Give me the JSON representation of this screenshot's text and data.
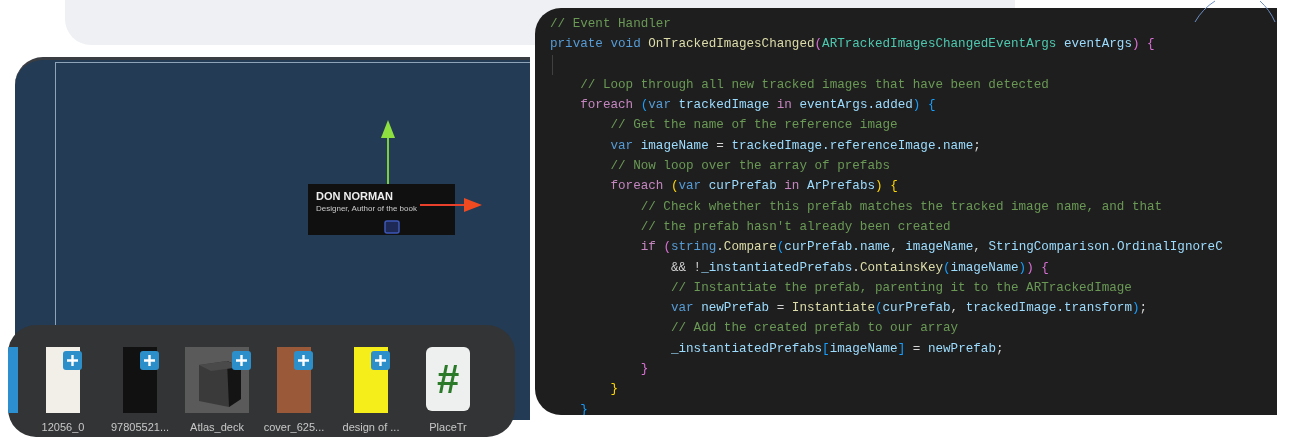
{
  "scene_view": {
    "card": {
      "title": "DON NORMAN",
      "subtitle": "Designer, Author of the book"
    }
  },
  "asset_strip": {
    "items": [
      {
        "kind": "photo",
        "color": "#2b8fd0"
      },
      {
        "kind": "photo",
        "label": "12056_0",
        "color": "#f2efe9"
      },
      {
        "kind": "photo",
        "label": "97805521...",
        "color": "#111111"
      },
      {
        "kind": "cube",
        "label": "Atlas_deck"
      },
      {
        "kind": "photo",
        "label": "cover_625...",
        "color": "#9a5a3a"
      },
      {
        "kind": "photo",
        "label": "design of ...",
        "color": "#f5ee1a"
      },
      {
        "kind": "script",
        "label": "PlaceTr",
        "glyph": "#"
      }
    ]
  },
  "code_editor": {
    "lines": [
      {
        "tokens": [
          {
            "kind": "comment",
            "text": "// Event Handler"
          }
        ]
      },
      {
        "tokens": [
          {
            "kind": "keyword",
            "text": "private void "
          },
          {
            "kind": "method",
            "text": "OnTrackedImagesChanged"
          },
          {
            "kind": "bracket2",
            "text": "("
          },
          {
            "kind": "type",
            "text": "ARTrackedImagesChangedEventArgs "
          },
          {
            "kind": "variable",
            "text": "eventArgs"
          },
          {
            "kind": "bracket2",
            "text": ") {"
          }
        ]
      },
      {
        "kind": "blank"
      },
      {
        "tokens": [
          {
            "kind": "comment",
            "text": "    // Loop through all new tracked images that have been detected"
          }
        ]
      },
      {
        "tokens": [
          {
            "kind": "control",
            "text": "    foreach "
          },
          {
            "kind": "bracket3",
            "text": "("
          },
          {
            "kind": "keyword",
            "text": "var "
          },
          {
            "kind": "variable",
            "text": "trackedImage "
          },
          {
            "kind": "control",
            "text": "in "
          },
          {
            "kind": "variable",
            "text": "eventArgs.added"
          },
          {
            "kind": "bracket3",
            "text": ") {"
          }
        ]
      },
      {
        "tokens": [
          {
            "kind": "comment",
            "text": "        // Get the name of the reference image"
          }
        ]
      },
      {
        "tokens": [
          {
            "kind": "keyword",
            "text": "        var "
          },
          {
            "kind": "variable",
            "text": "imageName "
          },
          {
            "kind": "plain",
            "text": "= "
          },
          {
            "kind": "variable",
            "text": "trackedImage.referenceImage.name"
          },
          {
            "kind": "plain",
            "text": ";"
          }
        ]
      },
      {
        "tokens": [
          {
            "kind": "comment",
            "text": "        // Now loop over the array of prefabs"
          }
        ]
      },
      {
        "tokens": [
          {
            "kind": "control",
            "text": "        foreach "
          },
          {
            "kind": "bracket1",
            "text": "("
          },
          {
            "kind": "keyword",
            "text": "var "
          },
          {
            "kind": "variable",
            "text": "curPrefab "
          },
          {
            "kind": "control",
            "text": "in "
          },
          {
            "kind": "variable",
            "text": "ArPrefabs"
          },
          {
            "kind": "bracket1",
            "text": ") {"
          }
        ]
      },
      {
        "tokens": [
          {
            "kind": "comment",
            "text": "            // Check whether this prefab matches the tracked image name, and that"
          }
        ]
      },
      {
        "tokens": [
          {
            "kind": "comment",
            "text": "            // the prefab hasn't already been created"
          }
        ]
      },
      {
        "tokens": [
          {
            "kind": "control",
            "text": "            if "
          },
          {
            "kind": "bracket2",
            "text": "("
          },
          {
            "kind": "keyword",
            "text": "string"
          },
          {
            "kind": "plain",
            "text": "."
          },
          {
            "kind": "method",
            "text": "Compare"
          },
          {
            "kind": "bracket3",
            "text": "("
          },
          {
            "kind": "variable",
            "text": "curPrefab.name"
          },
          {
            "kind": "plain",
            "text": ", "
          },
          {
            "kind": "variable",
            "text": "imageName"
          },
          {
            "kind": "plain",
            "text": ", "
          },
          {
            "kind": "variable",
            "text": "StringComparison.OrdinalIgnoreC"
          }
        ]
      },
      {
        "tokens": [
          {
            "kind": "plain",
            "text": "                && !"
          },
          {
            "kind": "variable",
            "text": "_instantiatedPrefabs"
          },
          {
            "kind": "plain",
            "text": "."
          },
          {
            "kind": "method",
            "text": "ContainsKey"
          },
          {
            "kind": "bracket3",
            "text": "("
          },
          {
            "kind": "variable",
            "text": "imageName"
          },
          {
            "kind": "bracket3",
            "text": ")"
          },
          {
            "kind": "bracket2",
            "text": ") {"
          }
        ]
      },
      {
        "tokens": [
          {
            "kind": "comment",
            "text": "                // Instantiate the prefab, parenting it to the ARTrackedImage"
          }
        ]
      },
      {
        "tokens": [
          {
            "kind": "keyword",
            "text": "                var "
          },
          {
            "kind": "variable",
            "text": "newPrefab "
          },
          {
            "kind": "plain",
            "text": "= "
          },
          {
            "kind": "method",
            "text": "Instantiate"
          },
          {
            "kind": "bracket3",
            "text": "("
          },
          {
            "kind": "variable",
            "text": "curPrefab"
          },
          {
            "kind": "plain",
            "text": ", "
          },
          {
            "kind": "variable",
            "text": "trackedImage.transform"
          },
          {
            "kind": "bracket3",
            "text": ")"
          },
          {
            "kind": "plain",
            "text": ";"
          }
        ]
      },
      {
        "tokens": [
          {
            "kind": "comment",
            "text": "                // Add the created prefab to our array"
          }
        ]
      },
      {
        "tokens": [
          {
            "kind": "variable",
            "text": "                _instantiatedPrefabs"
          },
          {
            "kind": "bracket3",
            "text": "["
          },
          {
            "kind": "variable",
            "text": "imageName"
          },
          {
            "kind": "bracket3",
            "text": "] "
          },
          {
            "kind": "plain",
            "text": "= "
          },
          {
            "kind": "variable",
            "text": "newPrefab"
          },
          {
            "kind": "plain",
            "text": ";"
          }
        ]
      },
      {
        "tokens": [
          {
            "kind": "bracket2",
            "text": "            }"
          }
        ]
      },
      {
        "tokens": [
          {
            "kind": "bracket1",
            "text": "        }"
          }
        ]
      },
      {
        "tokens": [
          {
            "kind": "bracket3",
            "text": "    }"
          }
        ]
      }
    ]
  }
}
